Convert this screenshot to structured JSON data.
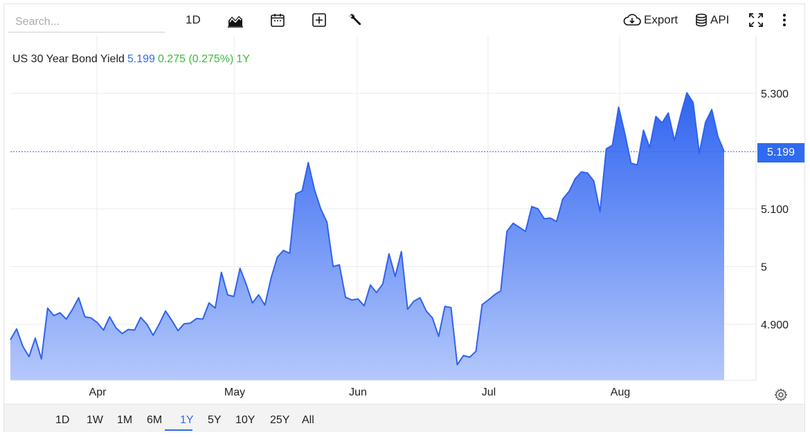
{
  "search": {
    "placeholder": "Search..."
  },
  "toolbar": {
    "interval_label": "1D",
    "export_label": "Export",
    "api_label": "API"
  },
  "legend": {
    "name": "US 30 Year Bond Yield",
    "last": "5.199",
    "change": "0.275 (0.275%)",
    "range": "1Y"
  },
  "price_label": "5.199",
  "colors": {
    "accent": "#2f6bf0",
    "line": "#2f62ee",
    "positive": "#3dbb3d",
    "grid": "#ebebeb"
  },
  "ranges": [
    {
      "label": "1D"
    },
    {
      "label": "1W"
    },
    {
      "label": "1M"
    },
    {
      "label": "6M"
    },
    {
      "label": "1Y",
      "active": true
    },
    {
      "label": "5Y"
    },
    {
      "label": "10Y"
    },
    {
      "label": "25Y"
    },
    {
      "label": "All"
    }
  ],
  "chart_data": {
    "type": "area",
    "ylim": [
      4.8,
      5.3
    ],
    "yticks": [
      {
        "value": 5.3,
        "label": "5.300"
      },
      {
        "value": 5.1,
        "label": "5.100"
      },
      {
        "value": 5.0,
        "label": "5"
      },
      {
        "value": 4.9,
        "label": "4.900"
      }
    ],
    "xticks": [
      {
        "label": "Apr",
        "index": 13.5
      },
      {
        "label": "May",
        "index": 35.5
      },
      {
        "label": "Jun",
        "index": 55.5
      },
      {
        "label": "Jul",
        "index": 76.5
      },
      {
        "label": "Aug",
        "index": 97.5
      }
    ],
    "last_value": 5.199,
    "values": [
      4.873,
      4.892,
      4.862,
      4.844,
      4.876,
      4.84,
      4.928,
      4.915,
      4.92,
      4.909,
      4.926,
      4.946,
      4.913,
      4.911,
      4.903,
      4.89,
      4.913,
      4.894,
      4.884,
      4.891,
      4.89,
      4.912,
      4.9,
      4.881,
      4.901,
      4.923,
      4.907,
      4.889,
      4.901,
      4.902,
      4.91,
      4.909,
      4.937,
      4.928,
      4.99,
      4.951,
      4.948,
      4.997,
      4.969,
      4.937,
      4.951,
      4.933,
      4.98,
      5.016,
      5.028,
      5.023,
      5.126,
      5.131,
      5.18,
      5.133,
      5.1,
      5.077,
      5.0,
      5.003,
      4.947,
      4.942,
      4.944,
      4.932,
      4.968,
      4.955,
      4.97,
      5.022,
      4.983,
      5.026,
      4.926,
      4.94,
      4.946,
      4.923,
      4.911,
      4.879,
      4.931,
      4.929,
      4.83,
      4.846,
      4.843,
      4.853,
      4.934,
      4.942,
      4.951,
      4.958,
      5.061,
      5.075,
      5.068,
      5.061,
      5.104,
      5.1,
      5.083,
      5.084,
      5.078,
      5.117,
      5.13,
      5.152,
      5.164,
      5.162,
      5.148,
      5.095,
      5.204,
      5.21,
      5.276,
      5.23,
      5.179,
      5.176,
      5.236,
      5.206,
      5.26,
      5.249,
      5.266,
      5.218,
      5.262,
      5.301,
      5.284,
      5.196,
      5.25,
      5.272,
      5.225,
      5.199
    ]
  }
}
